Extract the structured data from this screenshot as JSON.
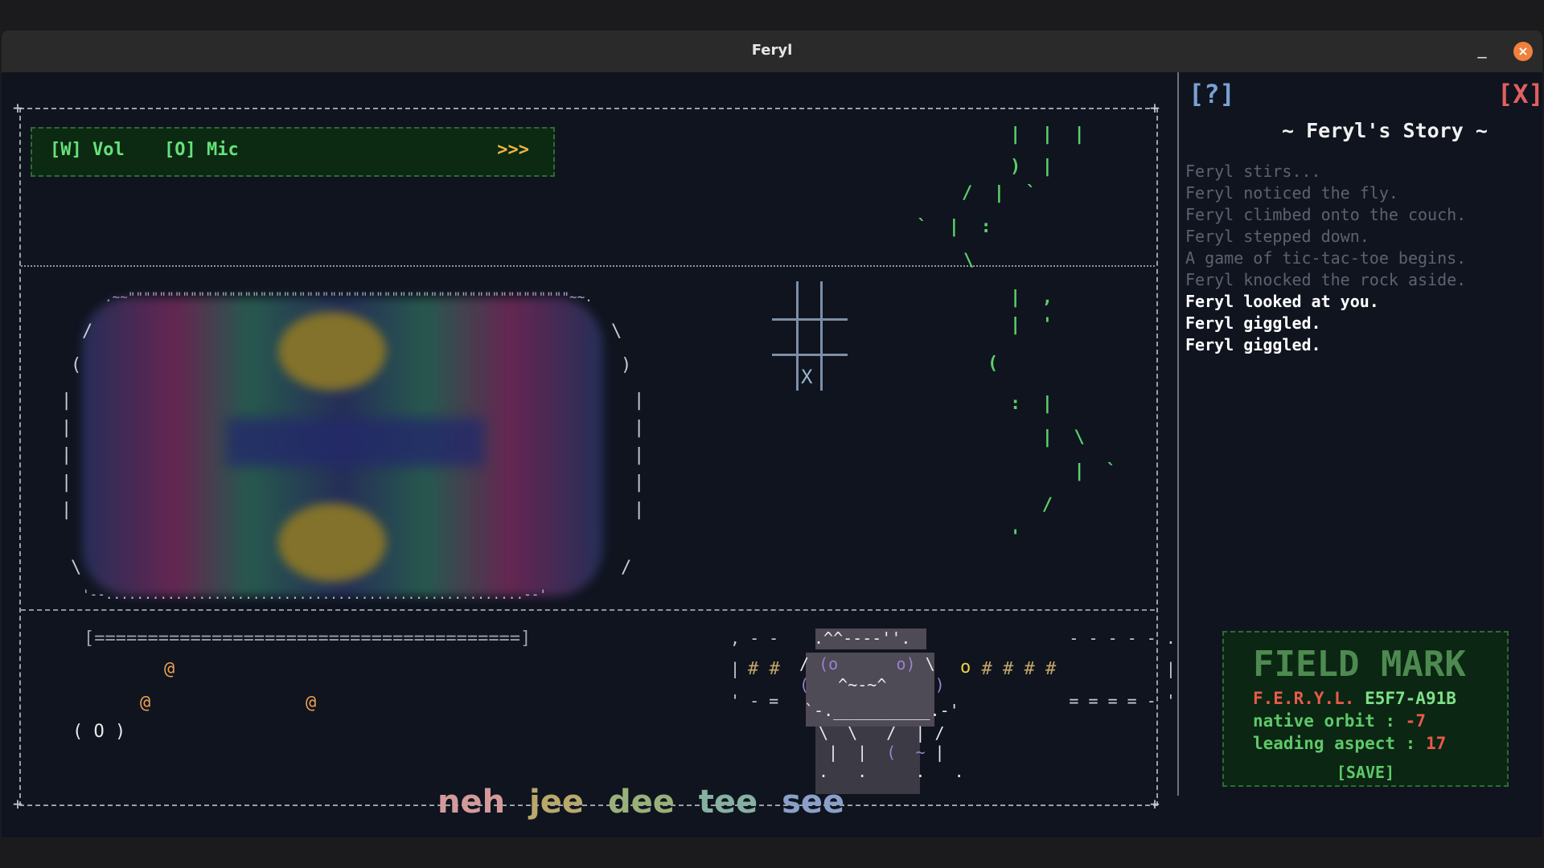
{
  "window": {
    "title": "Feryl",
    "minimize": "_",
    "close": "×"
  },
  "controls": {
    "vol": "[W] Vol",
    "mic": "[O] Mic",
    "next": ">>>"
  },
  "progress_bar": "[========================================]",
  "zero_widget": "( O )",
  "at_glyph": "@",
  "ttt_mark": "X",
  "syllables": [
    {
      "text": "neh",
      "color": "#d49a9a"
    },
    {
      "text": "jee",
      "color": "#b8a86a"
    },
    {
      "text": "dee",
      "color": "#9ab07a"
    },
    {
      "text": "tee",
      "color": "#86b0a0"
    },
    {
      "text": "see",
      "color": "#8aa0c8"
    }
  ],
  "side_panel": {
    "help": "[?]",
    "quit": "[X]",
    "story_title": "~ Feryl's Story ~",
    "log_old": [
      "Feryl stirs...",
      "Feryl noticed the fly.",
      "Feryl climbed onto the couch.",
      "Feryl stepped down.",
      "A game of tic-tac-toe begins.",
      "Feryl knocked the rock aside."
    ],
    "log_new": [
      "Feryl looked at you.",
      "Feryl giggled.",
      "Feryl giggled."
    ]
  },
  "field_mark": {
    "title": "FIELD MARK",
    "id_label": "F.E.R.Y.L.",
    "id_value": "E5F7-A91B",
    "orbit_label": "native orbit :",
    "orbit_value": "-7",
    "aspect_label": "leading aspect :",
    "aspect_value": "17",
    "save": "[SAVE]"
  },
  "colors": {
    "background": "#0f141f",
    "accent_green": "#66e27a",
    "accent_orange": "#f0b545",
    "field_mark_red": "#e85a4a"
  }
}
